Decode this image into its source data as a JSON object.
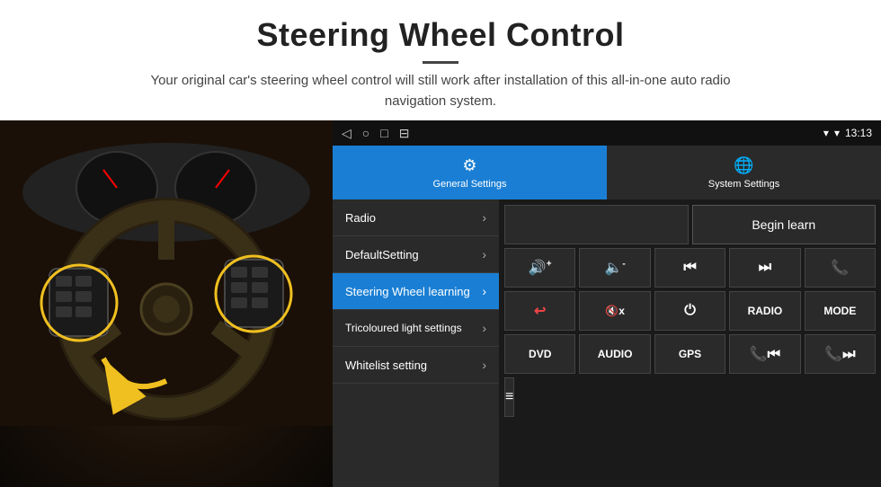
{
  "header": {
    "title": "Steering Wheel Control",
    "subtitle": "Your original car's steering wheel control will still work after installation of this all-in-one auto radio navigation system."
  },
  "status_bar": {
    "time": "13:13",
    "nav_icons": [
      "◁",
      "○",
      "□",
      "⊟"
    ]
  },
  "tabs": [
    {
      "id": "general",
      "label": "General Settings",
      "icon": "⚙",
      "active": true
    },
    {
      "id": "system",
      "label": "System Settings",
      "icon": "🌐",
      "active": false
    }
  ],
  "menu": {
    "items": [
      {
        "id": "radio",
        "label": "Radio",
        "selected": false
      },
      {
        "id": "default",
        "label": "DefaultSetting",
        "selected": false
      },
      {
        "id": "steering",
        "label": "Steering Wheel learning",
        "selected": true
      },
      {
        "id": "tricoloured",
        "label": "Tricoloured light settings",
        "selected": false
      },
      {
        "id": "whitelist",
        "label": "Whitelist setting",
        "selected": false
      }
    ]
  },
  "controls": {
    "begin_learn": "Begin learn",
    "buttons_row1": [
      {
        "id": "vol-up",
        "label": "🔊+"
      },
      {
        "id": "vol-down",
        "label": "🔈-"
      },
      {
        "id": "prev",
        "label": "⏮"
      },
      {
        "id": "next",
        "label": "⏭"
      },
      {
        "id": "phone",
        "label": "📞"
      }
    ],
    "buttons_row2": [
      {
        "id": "hang-up",
        "label": "📵"
      },
      {
        "id": "mute",
        "label": "🔇x"
      },
      {
        "id": "power",
        "label": "⏻"
      },
      {
        "id": "radio-btn",
        "label": "RADIO"
      },
      {
        "id": "mode",
        "label": "MODE"
      }
    ],
    "buttons_row3": [
      {
        "id": "dvd",
        "label": "DVD"
      },
      {
        "id": "audio",
        "label": "AUDIO"
      },
      {
        "id": "gps",
        "label": "GPS"
      },
      {
        "id": "tel-prev",
        "label": "📞⏮"
      },
      {
        "id": "tel-next",
        "label": "📞⏭"
      }
    ],
    "buttons_row4": [
      {
        "id": "menu-btn",
        "label": "≡"
      }
    ]
  }
}
